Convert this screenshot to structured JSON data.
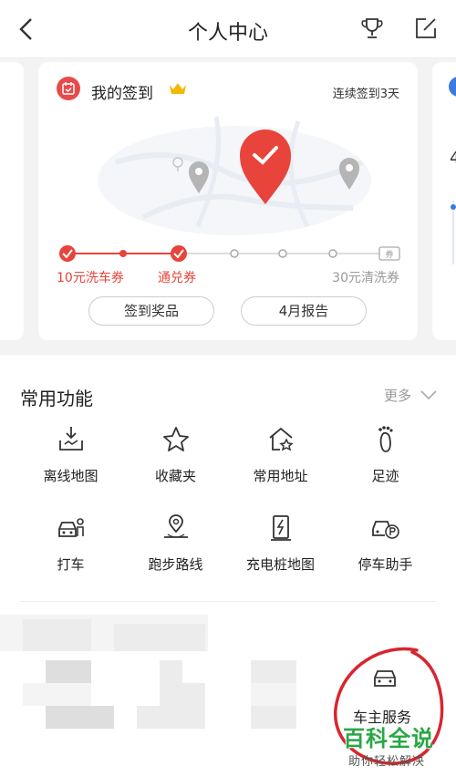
{
  "header": {
    "title": "个人中心"
  },
  "checkin": {
    "title": "我的签到",
    "streak": "连续签到3天",
    "label_first": "10元洗车券",
    "label_second": "通兑券",
    "label_last": "30元清洗券",
    "coupon_tag": "券",
    "button_prizes": "签到奖品",
    "button_report": "4月报告"
  },
  "peek_right": {
    "number": "4"
  },
  "functions": {
    "title": "常用功能",
    "more": "更多",
    "items": [
      {
        "label": "离线地图",
        "icon": "offline-map-icon"
      },
      {
        "label": "收藏夹",
        "icon": "star-icon"
      },
      {
        "label": "常用地址",
        "icon": "home-star-icon"
      },
      {
        "label": "足迹",
        "icon": "footprint-icon"
      },
      {
        "label": "打车",
        "icon": "taxi-icon"
      },
      {
        "label": "跑步路线",
        "icon": "running-route-icon"
      },
      {
        "label": "充电桩地图",
        "icon": "charging-pile-icon"
      },
      {
        "label": "停车助手",
        "icon": "parking-icon"
      }
    ],
    "car_service": "车主服务"
  },
  "watermark": {
    "main": "百科全说",
    "sub": "助你轻松解决"
  },
  "colors": {
    "accent": "#e84a4a",
    "watermark": "#29a745"
  }
}
